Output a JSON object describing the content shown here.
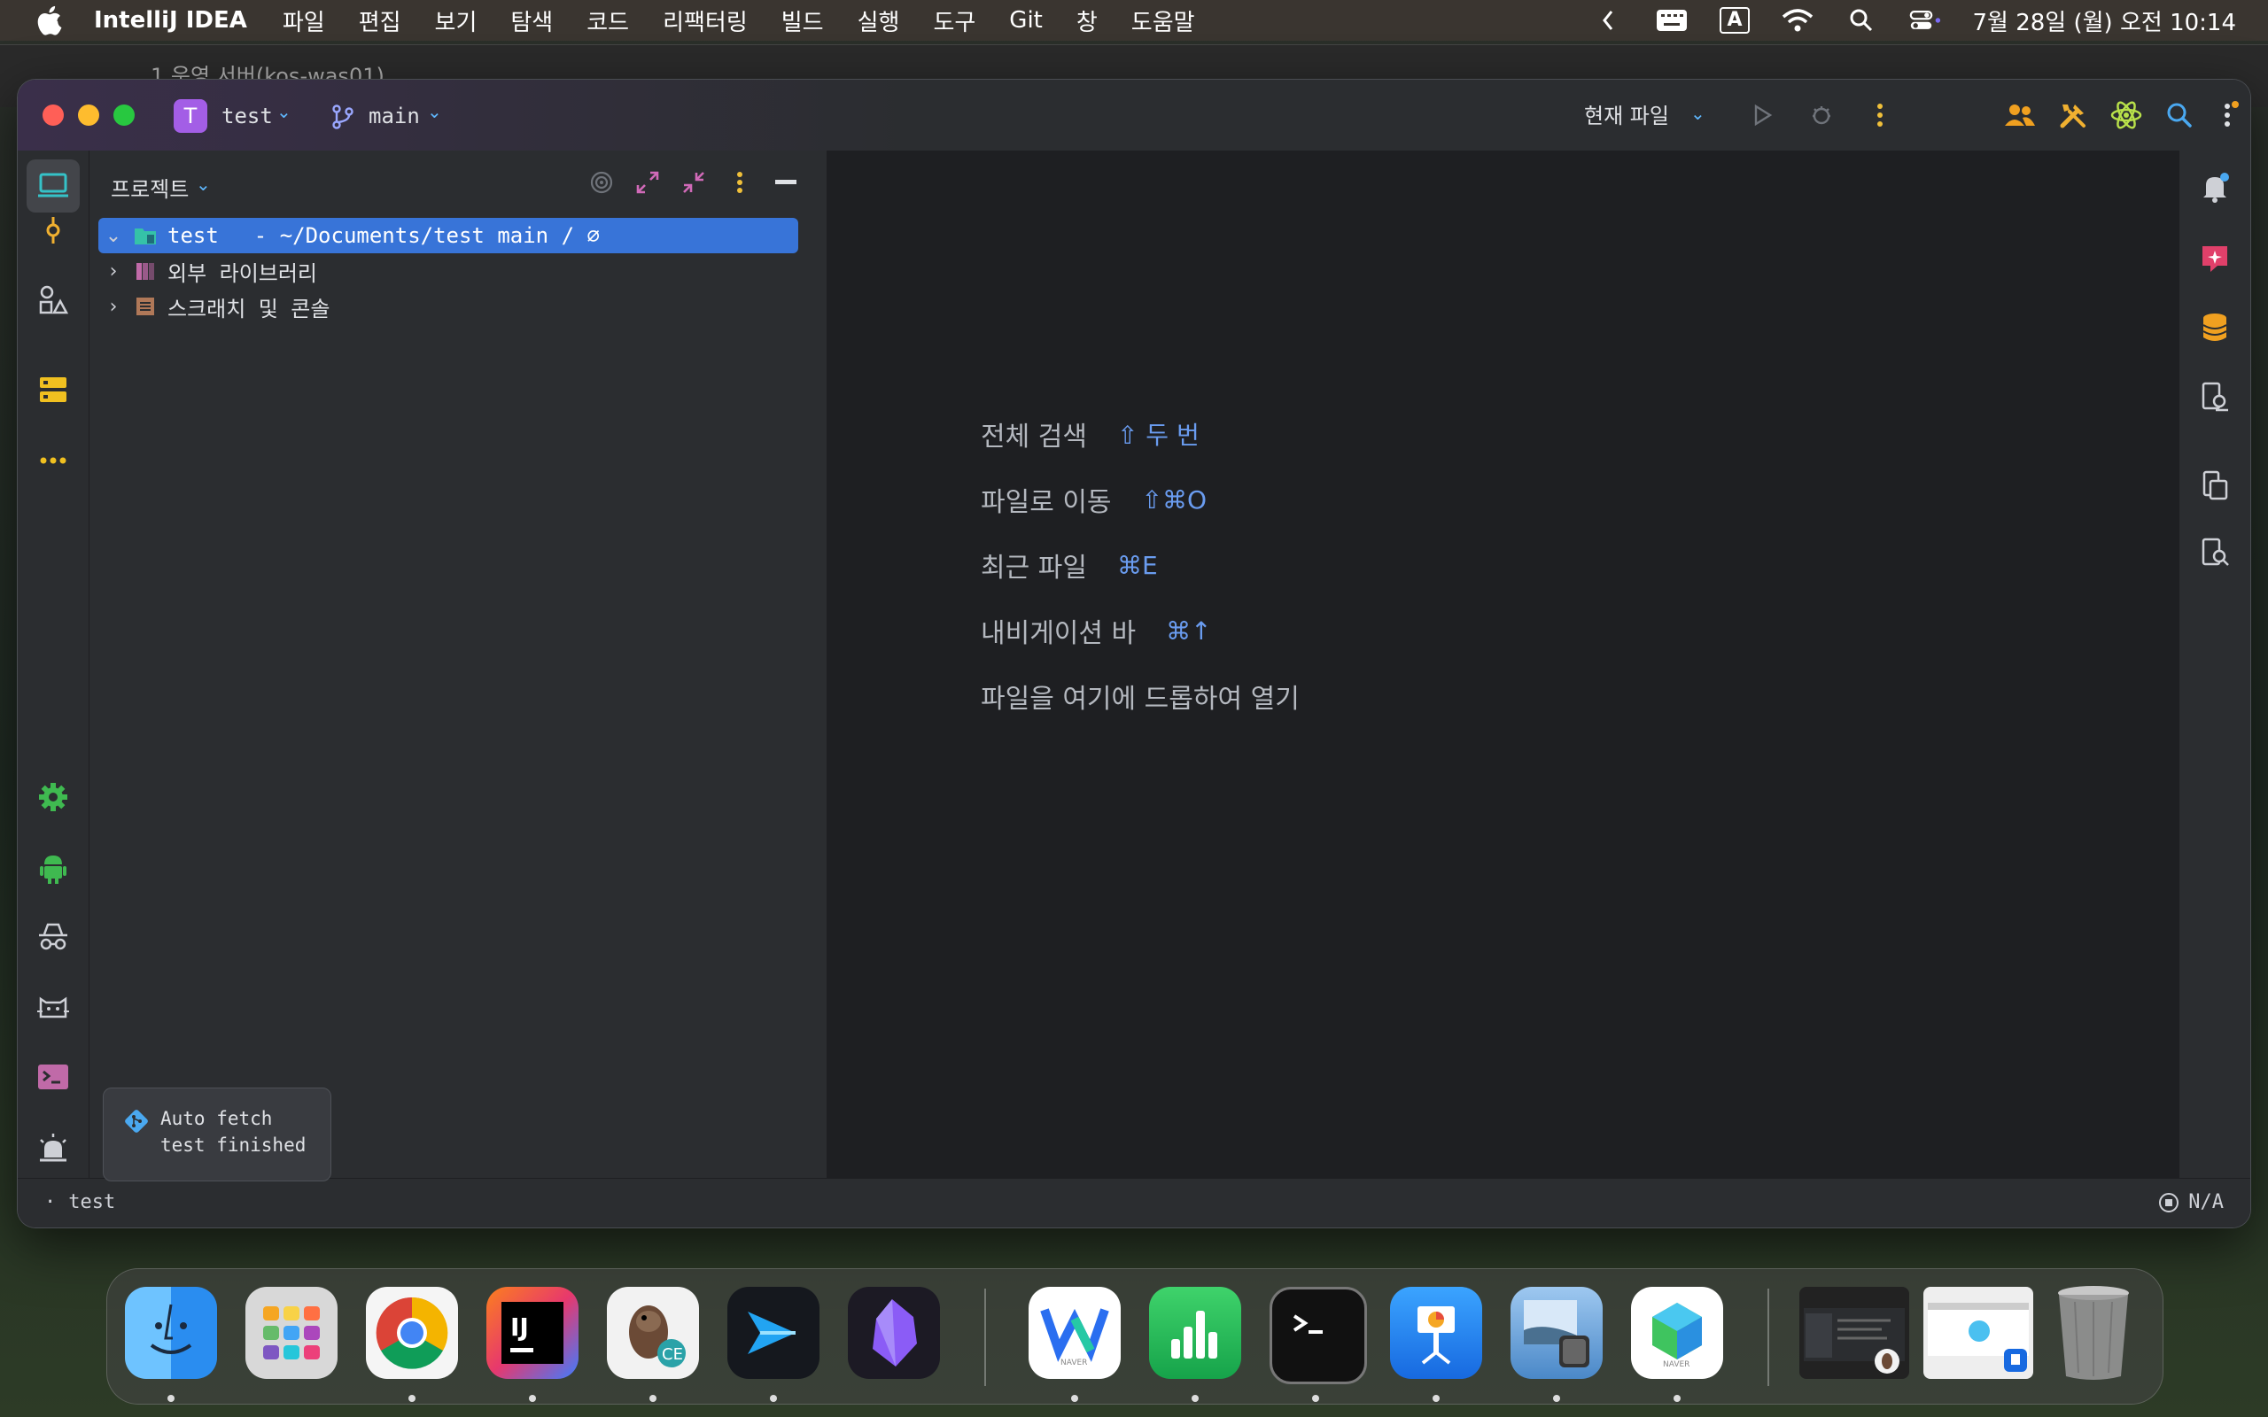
{
  "menubar": {
    "app_name": "IntelliJ IDEA",
    "items": [
      "파일",
      "편집",
      "보기",
      "탐색",
      "코드",
      "리팩터링",
      "빌드",
      "실행",
      "도구",
      "Git",
      "창",
      "도움말"
    ],
    "ime_label": "A",
    "clock": "7월 28일 (월) 오전 10:14"
  },
  "background_window": {
    "tab_label": "1 운영 서버(kos-was01)"
  },
  "titlebar": {
    "project_badge": "T",
    "project_name": "test",
    "branch_name": "main",
    "run_config": "현재 파일"
  },
  "project_panel": {
    "title": "프로젝트",
    "tree": [
      {
        "label": "test",
        "path": "- ~/Documents/test main / ⌀",
        "expanded": true,
        "selected": true
      },
      {
        "label": "외부 라이브러리",
        "expanded": false
      },
      {
        "label": "스크래치 및 콘솔",
        "expanded": false
      }
    ]
  },
  "editor": {
    "hints": [
      {
        "label": "전체 검색",
        "shortcut": "⇧ 두 번"
      },
      {
        "label": "파일로 이동",
        "shortcut": "⇧⌘O"
      },
      {
        "label": "최근 파일",
        "shortcut": "⌘E"
      },
      {
        "label": "내비게이션 바",
        "shortcut": "⌘↑"
      },
      {
        "label": "파일을 여기에 드롭하여 열기",
        "shortcut": ""
      }
    ]
  },
  "toast": {
    "line1": "Auto fetch",
    "line2": "test finished"
  },
  "statusbar": {
    "project": "test",
    "right": "N/A"
  },
  "colors": {
    "accent": "#3874d8",
    "shortcut": "#6a9cf0",
    "panel": "#2b2d30",
    "editor": "#1e1f22"
  },
  "dock_apps": [
    "finder",
    "launchpad",
    "chrome",
    "intellij-idea",
    "dbeaver-ce",
    "code-editor",
    "obsidian",
    "naver-whale",
    "numbers",
    "terminal",
    "keynote",
    "preview",
    "naver-app",
    "window-preview-1",
    "window-preview-2",
    "trash"
  ]
}
